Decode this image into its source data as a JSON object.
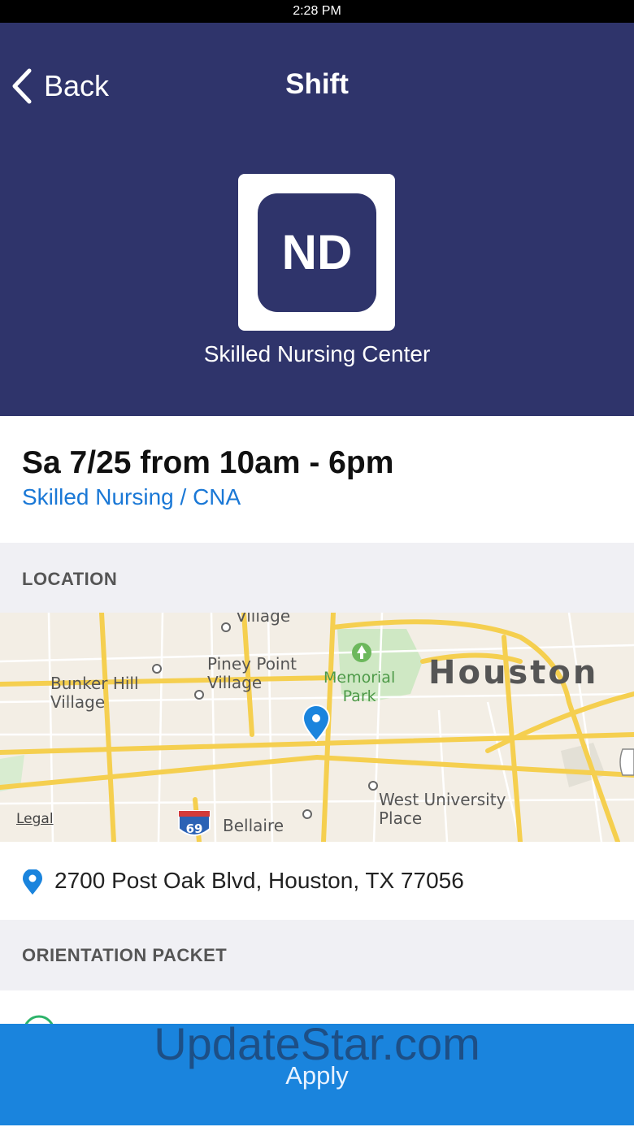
{
  "status_bar": {
    "time": "2:28 PM"
  },
  "nav": {
    "back_label": "Back",
    "title": "Shift"
  },
  "facility": {
    "logo_text": "ND",
    "name": "Skilled Nursing Center"
  },
  "shift": {
    "time": "Sa 7/25 from 10am - 6pm",
    "role": "Skilled Nursing / CNA"
  },
  "location": {
    "section_title": "LOCATION",
    "map": {
      "labels": {
        "village_top": "Village",
        "piney_point": "Piney Point\nVillage",
        "bunker_hill": "Bunker Hill\nVillage",
        "memorial_park": "Memorial\nPark",
        "houston": "Houston",
        "west_university": "West University\nPlace",
        "bellaire": "Bellaire",
        "legal": "Legal",
        "highway_69": "69"
      }
    },
    "address": "2700 Post Oak Blvd, Houston, TX 77056"
  },
  "orientation": {
    "section_title": "ORIENTATION PACKET"
  },
  "apply_label": "Apply",
  "watermark": "UpdateStar.com",
  "colors": {
    "header": "#2f346b",
    "accent": "#1a84dd",
    "link": "#1a78d6"
  }
}
